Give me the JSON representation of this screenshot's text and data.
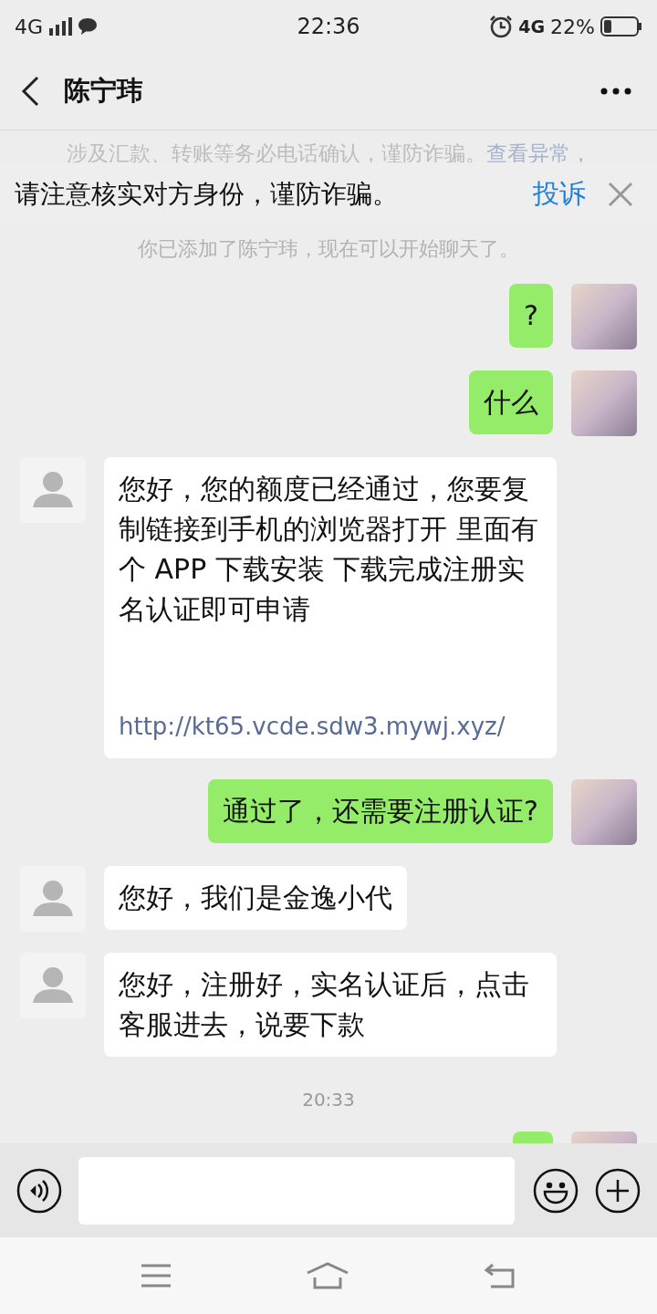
{
  "status_bar": {
    "network": "4G",
    "time": "22:36",
    "network_right": "4G",
    "battery": "22%"
  },
  "header": {
    "title": "陈宁玮"
  },
  "notice": {
    "text": "涉及汇款、转账等务必电话确认，谨防诈骗。",
    "link": "查看异常，"
  },
  "banner": {
    "text": "请注意核实对方身份，谨防诈骗。",
    "action": "投诉"
  },
  "messages": [
    {
      "kind": "system",
      "text": "你已添加了陈宁玮，现在可以开始聊天了。"
    },
    {
      "kind": "sent",
      "text": "?"
    },
    {
      "kind": "sent",
      "text": "什么"
    },
    {
      "kind": "received",
      "text": "您好，您的额度已经通过，您要复制链接到手机的浏览器打开 里面有个 APP 下载安装 下载完成注册实名认证即可申请",
      "link": "http://kt65.vcde.sdw3.mywj.xyz/"
    },
    {
      "kind": "sent",
      "text": "通过了，还需要注册认证?"
    },
    {
      "kind": "received",
      "text": "您好，我们是金逸小代"
    },
    {
      "kind": "received",
      "text": "您好，注册好，实名认证后，点击客服进去，说要下款"
    },
    {
      "kind": "time",
      "text": "20:33"
    },
    {
      "kind": "sent"
    }
  ]
}
